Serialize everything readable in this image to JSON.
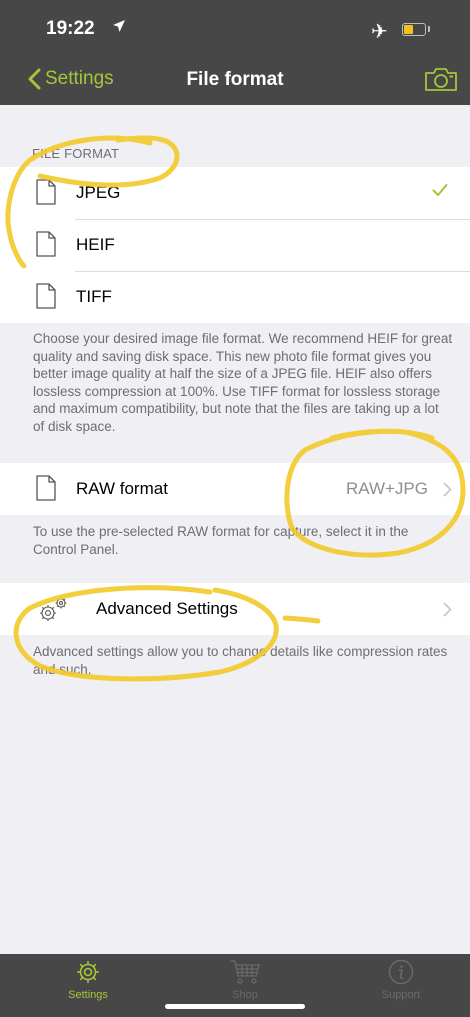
{
  "status_bar": {
    "time": "19:22"
  },
  "nav": {
    "back_label": "Settings",
    "title": "File format"
  },
  "file_format": {
    "header": "FILE FORMAT",
    "options": [
      {
        "label": "JPEG",
        "selected": true
      },
      {
        "label": "HEIF",
        "selected": false
      },
      {
        "label": "TIFF",
        "selected": false
      }
    ],
    "description": "Choose your desired image file format. We recommend HEIF for great quality and saving disk space. This new photo file format gives you better image quality at half the size of a JPEG file. HEIF also offers lossless compression at 100%. Use TIFF format for lossless storage and maximum compatibility, but note that the files are taking up a lot of disk space."
  },
  "raw": {
    "label": "RAW format",
    "value": "RAW+JPG",
    "description": "To use the pre-selected RAW format for capture, select it in the Control Panel."
  },
  "advanced": {
    "label": "Advanced Settings",
    "description": "Advanced settings allow you to change details like compression rates and such."
  },
  "tabs": [
    {
      "label": "Settings",
      "active": true
    },
    {
      "label": "Shop",
      "active": false
    },
    {
      "label": "Support",
      "active": false
    }
  ],
  "colors": {
    "accent": "#a4c639",
    "bar": "#474747",
    "annotation": "#f2c928",
    "inactive_tab": "#6a6a6a"
  }
}
